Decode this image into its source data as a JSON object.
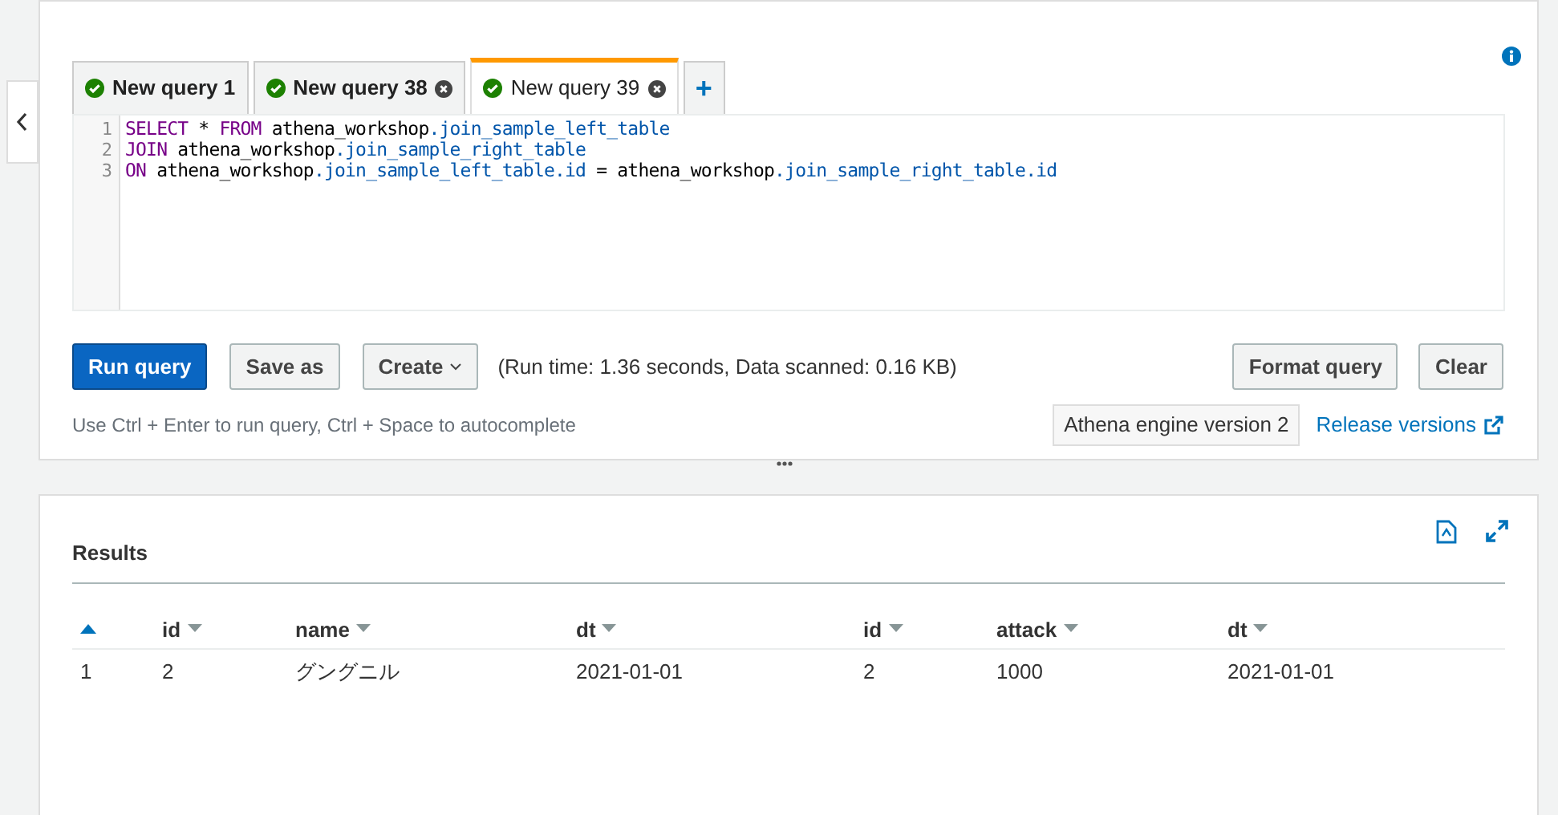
{
  "tabs": [
    {
      "label": "New query 1",
      "succeeded": true,
      "closable": false,
      "selected": false
    },
    {
      "label": "New query 38",
      "succeeded": true,
      "closable": true,
      "selected": false
    },
    {
      "label": "New query 39",
      "succeeded": true,
      "closable": true,
      "selected": true
    }
  ],
  "add_tab": "+",
  "editor": {
    "lines": [
      {
        "number": "1",
        "tokens": [
          {
            "kind": "keyword",
            "text": "SELECT"
          },
          {
            "kind": "plain",
            "text": " * "
          },
          {
            "kind": "keyword",
            "text": "FROM"
          },
          {
            "kind": "plain",
            "text": " athena_workshop"
          },
          {
            "kind": "member",
            "text": ".join_sample_left_table"
          }
        ]
      },
      {
        "number": "2",
        "tokens": [
          {
            "kind": "keyword",
            "text": "JOIN"
          },
          {
            "kind": "plain",
            "text": " athena_workshop"
          },
          {
            "kind": "member",
            "text": ".join_sample_right_table"
          }
        ]
      },
      {
        "number": "3",
        "tokens": [
          {
            "kind": "keyword",
            "text": "ON"
          },
          {
            "kind": "plain",
            "text": " athena_workshop"
          },
          {
            "kind": "member",
            "text": ".join_sample_left_table.id"
          },
          {
            "kind": "plain",
            "text": " = athena_workshop"
          },
          {
            "kind": "member",
            "text": ".join_sample_right_table.id"
          }
        ]
      }
    ]
  },
  "actions": [
    {
      "label": "Run query",
      "kind": "primary"
    },
    {
      "label": "Save as",
      "kind": "plain"
    },
    {
      "label": "Create",
      "kind": "dropdown"
    }
  ],
  "run_info": "(Run time: 1.36 seconds, Data scanned: 0.16 KB)",
  "right_actions": [
    "Format query",
    "Clear"
  ],
  "hint": "Use Ctrl + Enter to run query, Ctrl + Space to autocomplete",
  "engine_badge": "Athena engine version 2",
  "release_link": "Release versions",
  "results": {
    "title": "Results",
    "sorted_ascending": true,
    "columns": [
      "",
      "id",
      "name",
      "dt",
      "id",
      "attack",
      "dt"
    ],
    "rows": [
      [
        "1",
        "2",
        "グングニル",
        "2021-01-01",
        "2",
        "1000",
        "2021-01-01"
      ]
    ]
  }
}
